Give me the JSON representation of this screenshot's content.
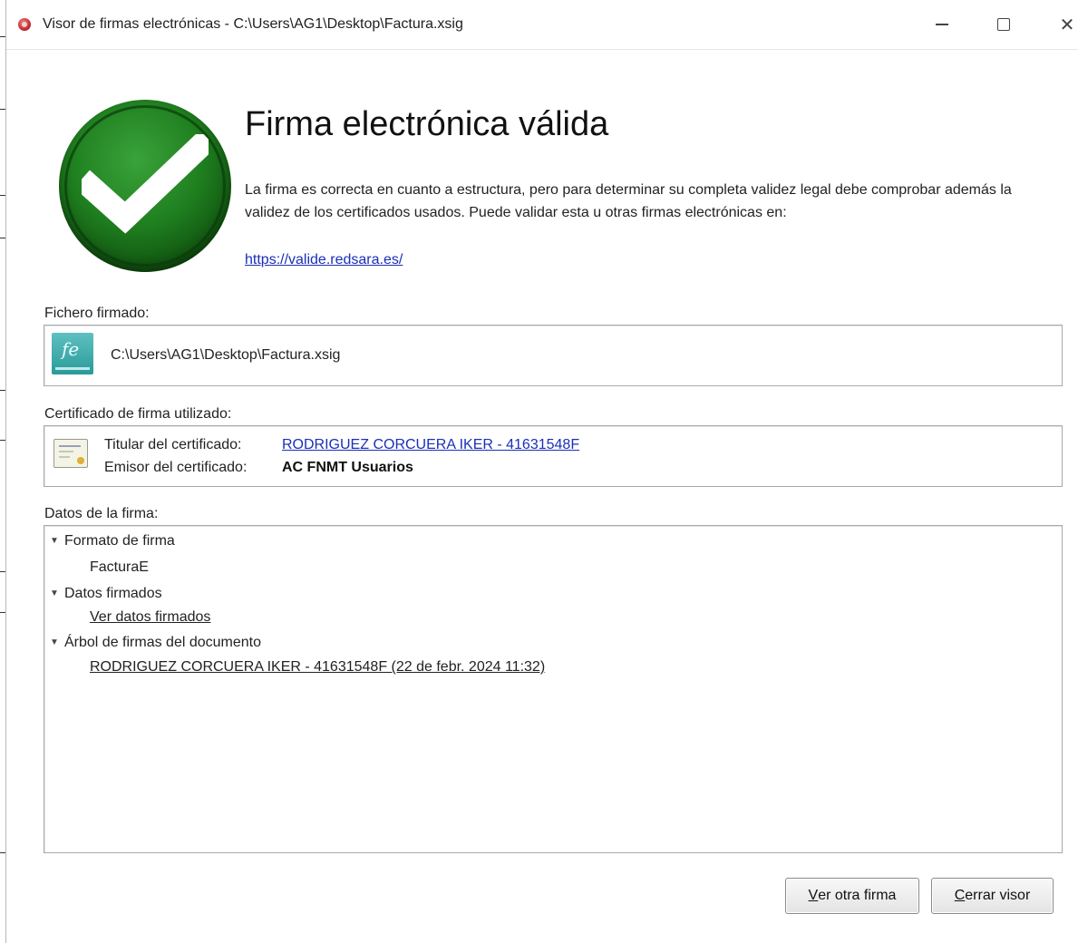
{
  "window": {
    "title": "Visor de firmas electrónicas - C:\\Users\\AG1\\Desktop\\Factura.xsig",
    "app_icon": "red-seal-icon",
    "controls": {
      "minimize": "minimize-icon",
      "maximize": "maximize-icon",
      "close": "close-icon"
    }
  },
  "header": {
    "status_icon": "green-check-icon",
    "title": "Firma electrónica válida",
    "description": "La firma es correcta en cuanto a estructura, pero para determinar su completa validez legal debe comprobar además la validez de los certificados usados. Puede validar esta u otras firmas electrónicas en:",
    "validation_url": "https://valide.redsara.es/"
  },
  "signed_file": {
    "label": "Fichero firmado:",
    "icon": "facturae-file-icon",
    "path": "C:\\Users\\AG1\\Desktop\\Factura.xsig"
  },
  "certificate": {
    "label": "Certificado de firma utilizado:",
    "icon": "certificate-icon",
    "holder_label": "Titular del certificado:",
    "holder_value": "RODRIGUEZ CORCUERA IKER - 41631548F",
    "issuer_label": "Emisor del certificado:",
    "issuer_value": "AC FNMT Usuarios"
  },
  "signature_data": {
    "label": "Datos de la firma:",
    "tree": [
      {
        "heading": "Formato de firma",
        "value": "FacturaE",
        "value_is_link": false
      },
      {
        "heading": "Datos firmados",
        "value": "Ver datos firmados",
        "value_is_link": true
      },
      {
        "heading": "Árbol de firmas del documento",
        "value": "RODRIGUEZ CORCUERA IKER - 41631548F (22 de febr. 2024 11:32)",
        "value_is_link": true
      }
    ]
  },
  "buttons": {
    "other_signature": {
      "mnemonic": "V",
      "rest": "er otra firma"
    },
    "close_viewer": {
      "mnemonic": "C",
      "rest": "errar visor"
    }
  },
  "colors": {
    "link": "#1a2fb8",
    "check_green": "#1f7f1f",
    "panel_border": "#a9a9a9"
  }
}
